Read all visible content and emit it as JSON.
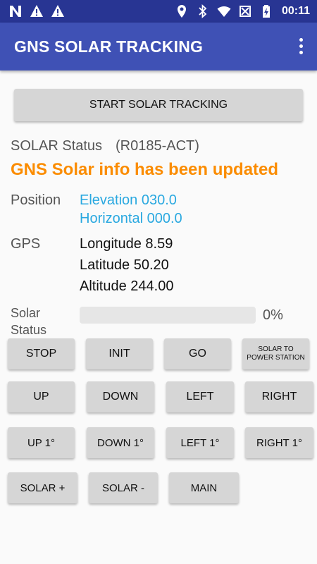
{
  "statusbar": {
    "time": "00:11",
    "left_icons": [
      "n-icon",
      "warning-icon",
      "warning-icon"
    ],
    "right_icons": [
      "location-icon",
      "bluetooth-icon",
      "wifi-icon",
      "no-sim-icon",
      "battery-icon"
    ]
  },
  "appbar": {
    "title": "GNS SOLAR TRACKING",
    "menu_icon": "more-vert-icon"
  },
  "start_button": "START SOLAR TRACKING",
  "solar_status": {
    "label": "SOLAR Status",
    "code": "(R0185-ACT)",
    "message": "GNS Solar info has been updated"
  },
  "position": {
    "label": "Position",
    "elevation": "Elevation 030.0",
    "horizontal": "Horizontal 000.0"
  },
  "gps": {
    "label": "GPS",
    "longitude": "Longitude 8.59",
    "latitude": "Latitude 50.20",
    "altitude": "Altitude 244.00"
  },
  "progress": {
    "label_line1": "Solar",
    "label_line2": "Status",
    "value": 0,
    "text": "0%"
  },
  "buttons": {
    "stop": "STOP",
    "init": "INIT",
    "go": "GO",
    "solar_to_power_station": "SOLAR TO POWER STATION",
    "up": "UP",
    "down": "DOWN",
    "left": "LEFT",
    "right": "RIGHT",
    "up1": "UP 1°",
    "down1": "DOWN 1°",
    "left1": "LEFT 1°",
    "right1": "RIGHT 1°",
    "solar_plus": "SOLAR +",
    "solar_minus": "SOLAR -",
    "main": "MAIN"
  },
  "colors": {
    "status_bar": "#283593",
    "app_bar": "#3f51b5",
    "accent_orange": "#fb8c00",
    "accent_blue": "#29a8e0",
    "button": "#d6d6d6"
  }
}
